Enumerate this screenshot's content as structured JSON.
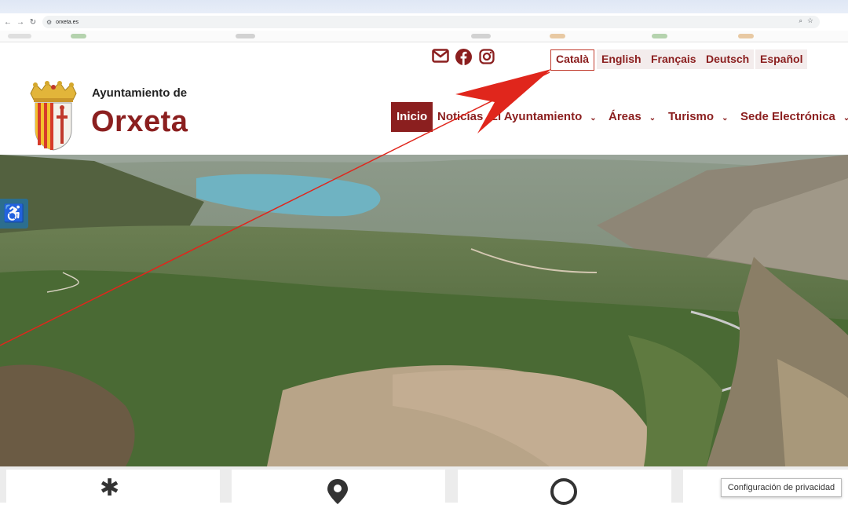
{
  "browser": {
    "url": "orxeta.es"
  },
  "header": {
    "title_small": "Ayuntamiento de",
    "title_big": "Orxeta",
    "social": [
      "mail-icon",
      "facebook-icon",
      "instagram-icon"
    ],
    "languages": [
      {
        "label": "Català",
        "active": true
      },
      {
        "label": "English"
      },
      {
        "label": "Français"
      },
      {
        "label": "Deutsch"
      },
      {
        "label": "Español"
      }
    ],
    "nav": [
      {
        "label": "Inicio",
        "active": true
      },
      {
        "label": "Noticias"
      },
      {
        "label": "El Ayuntamiento",
        "dropdown": true
      },
      {
        "label": "Áreas",
        "dropdown": true
      },
      {
        "label": "Turismo",
        "dropdown": true
      },
      {
        "label": "Sede Electrónica",
        "dropdown": true
      }
    ]
  },
  "colors": {
    "brand": "#8b1f1f",
    "accessibility": "#2c6e8f",
    "annotation": "#e0261c"
  },
  "privacy_button": "Configuración de privacidad",
  "cards": [
    "asterisk-icon",
    "location-pin-icon",
    "circle-icon",
    "card"
  ]
}
